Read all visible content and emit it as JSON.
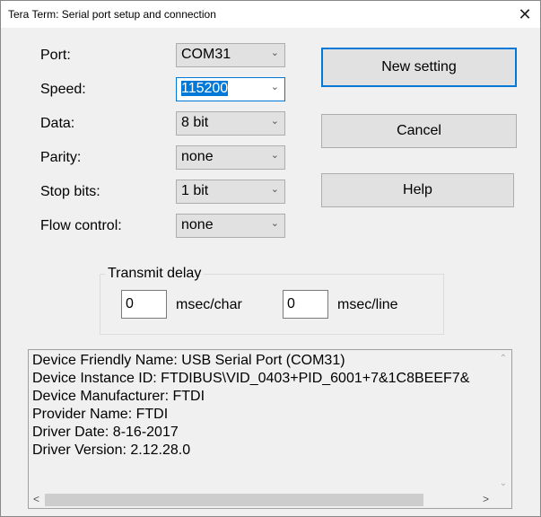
{
  "window": {
    "title": "Tera Term: Serial port setup and connection",
    "close": "✕"
  },
  "fields": [
    {
      "label": "Port:",
      "value": "COM31"
    },
    {
      "label": "Speed:",
      "value": "115200"
    },
    {
      "label": "Data:",
      "value": "8 bit"
    },
    {
      "label": "Parity:",
      "value": "none"
    },
    {
      "label": "Stop bits:",
      "value": "1 bit"
    },
    {
      "label": "Flow control:",
      "value": "none"
    }
  ],
  "buttons": {
    "new_setting": "New setting",
    "cancel": "Cancel",
    "help": "Help"
  },
  "transmit_delay": {
    "label": "Transmit delay",
    "char_value": "0",
    "char_unit": "msec/char",
    "line_value": "0",
    "line_unit": "msec/line"
  },
  "info_lines": [
    "Device Friendly Name: USB Serial Port (COM31)",
    "Device Instance ID: FTDIBUS\\VID_0403+PID_6001+7&1C8BEEF7&",
    "Device Manufacturer: FTDI",
    "Provider Name: FTDI",
    "Driver Date: 8-16-2017",
    "Driver Version: 2.12.28.0"
  ],
  "arrows": {
    "down": "⌄",
    "up": "⌃",
    "left": "<",
    "right": ">"
  }
}
